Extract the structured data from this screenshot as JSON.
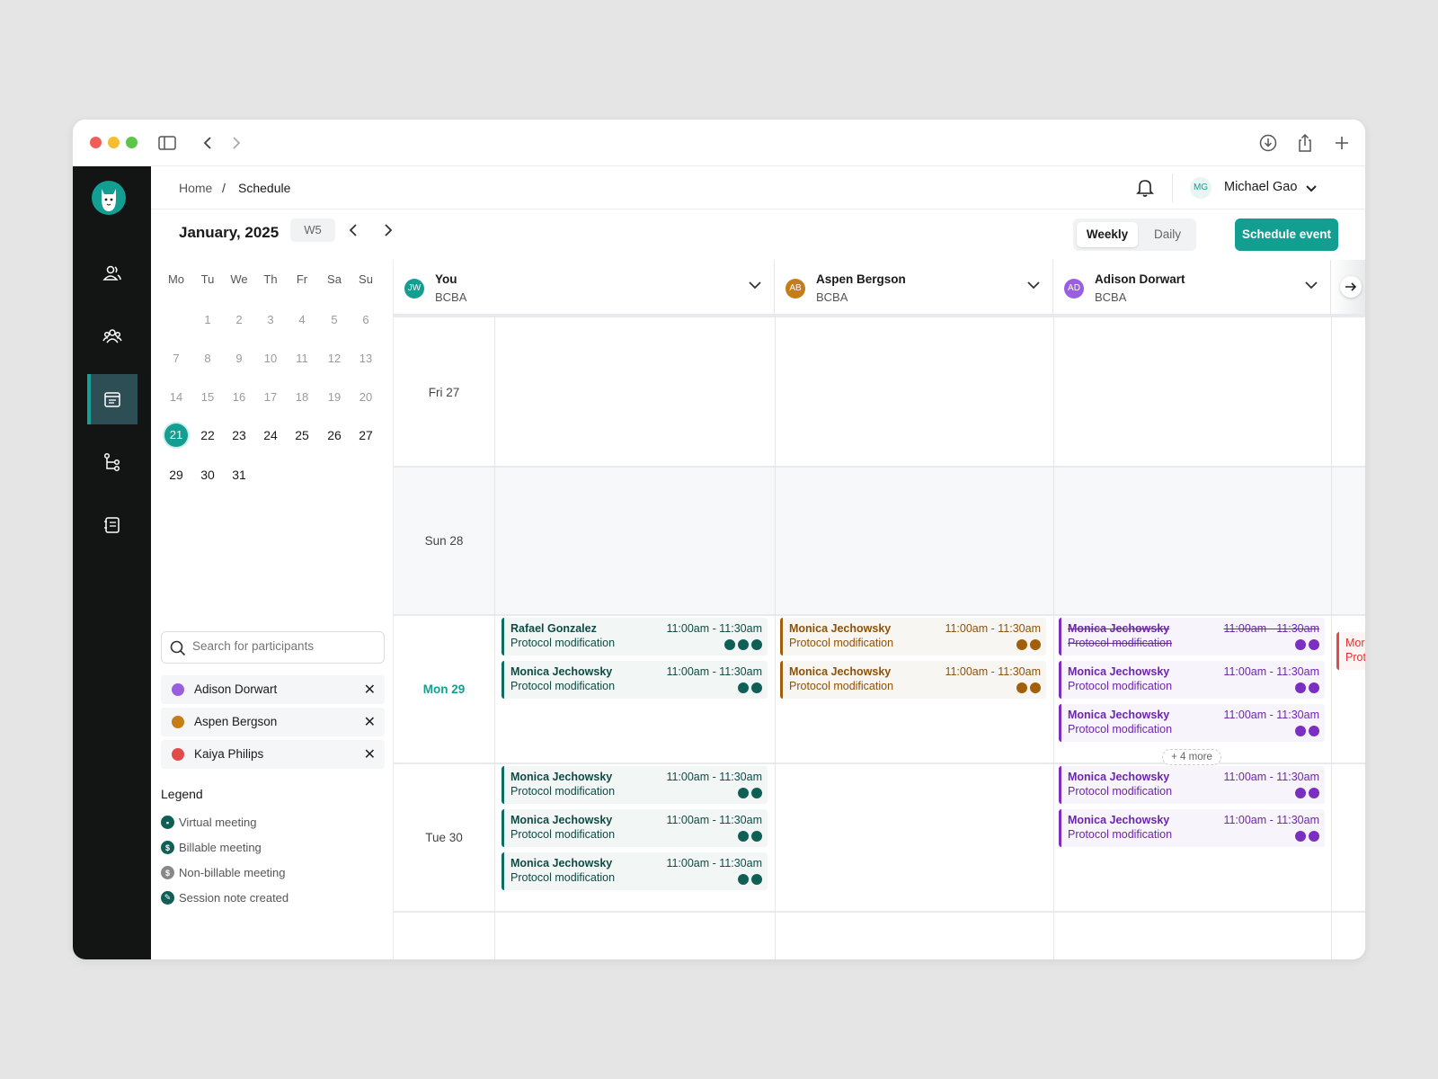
{
  "breadcrumb": {
    "home": "Home",
    "sep": "/",
    "current": "Schedule"
  },
  "user": {
    "initials": "MG",
    "name": "Michael Gao"
  },
  "period": {
    "month": "January, 2025",
    "week": "W5"
  },
  "view_toggle": {
    "weekly": "Weekly",
    "daily": "Daily",
    "active": "Weekly"
  },
  "schedule_button": "Schedule event",
  "mini_cal": {
    "day_headers": [
      "Mo",
      "Tu",
      "We",
      "Th",
      "Fr",
      "Sa",
      "Su"
    ],
    "weeks": [
      [
        "",
        "1",
        "2",
        "3",
        "4",
        "5",
        "6"
      ],
      [
        "7",
        "8",
        "9",
        "10",
        "11",
        "12",
        "13"
      ],
      [
        "14",
        "15",
        "16",
        "17",
        "18",
        "19",
        "20"
      ],
      [
        "21",
        "22",
        "23",
        "24",
        "25",
        "26",
        "27"
      ],
      [
        "29",
        "30",
        "31",
        "",
        "",
        "",
        ""
      ]
    ],
    "selected": "21"
  },
  "search": {
    "placeholder": "Search for participants"
  },
  "participants": [
    {
      "name": "Adison Dorwart",
      "color": "#9a5fe0"
    },
    {
      "name": "Aspen Bergson",
      "color": "#c47d17"
    },
    {
      "name": "Kaiya Philips",
      "color": "#e34b4b"
    }
  ],
  "legend": {
    "title": "Legend",
    "items": [
      "Virtual meeting",
      "Billable meeting",
      "Non-billable meeting",
      "Session note created"
    ]
  },
  "columns": [
    {
      "initials": "JW",
      "name": "You",
      "role": "BCBA",
      "color": "#139e92"
    },
    {
      "initials": "AB",
      "name": "Aspen Bergson",
      "role": "BCBA",
      "color": "#c47d17"
    },
    {
      "initials": "AD",
      "name": "Adison Dorwart",
      "role": "BCBA",
      "color": "#9a5fe0"
    }
  ],
  "rows": [
    "Fri 27",
    "Sun 28",
    "Mon 29",
    "Tue 30"
  ],
  "events": {
    "you_mon": [
      {
        "name": "Rafael Gonzalez",
        "sub": "Protocol modification",
        "time": "11:00am - 11:30am"
      },
      {
        "name": "Monica Jechowsky",
        "sub": "Protocol modification",
        "time": "11:00am - 11:30am"
      }
    ],
    "you_tue": [
      {
        "name": "Monica Jechowsky",
        "sub": "Protocol modification",
        "time": "11:00am - 11:30am"
      },
      {
        "name": "Monica Jechowsky",
        "sub": "Protocol modification",
        "time": "11:00am - 11:30am"
      },
      {
        "name": "Monica Jechowsky",
        "sub": "Protocol modification",
        "time": "11:00am - 11:30am"
      }
    ],
    "aspen_mon": [
      {
        "name": "Monica Jechowsky",
        "sub": "Protocol modification",
        "time": "11:00am - 11:30am"
      },
      {
        "name": "Monica Jechowsky",
        "sub": "Protocol modification",
        "time": "11:00am - 11:30am"
      }
    ],
    "adison_mon": [
      {
        "name": "Monica Jechowsky",
        "sub": "Protocol modification",
        "time": "11:00am - 11:30am"
      },
      {
        "name": "Monica Jechowsky",
        "sub": "Protocol modification",
        "time": "11:00am - 11:30am"
      },
      {
        "name": "Monica Jechowsky",
        "sub": "Protocol modification",
        "time": "11:00am - 11:30am"
      }
    ],
    "adison_tue": [
      {
        "name": "Monica Jechowsky",
        "sub": "Protocol modification",
        "time": "11:00am - 11:30am"
      },
      {
        "name": "Monica Jechowsky",
        "sub": "Protocol modification",
        "time": "11:00am - 11:30am"
      }
    ],
    "more": "+ 4 more",
    "overflow_partial": [
      "Mor",
      "Prot"
    ]
  },
  "colors": {
    "accent": "#139e92",
    "rail": "#131514"
  }
}
